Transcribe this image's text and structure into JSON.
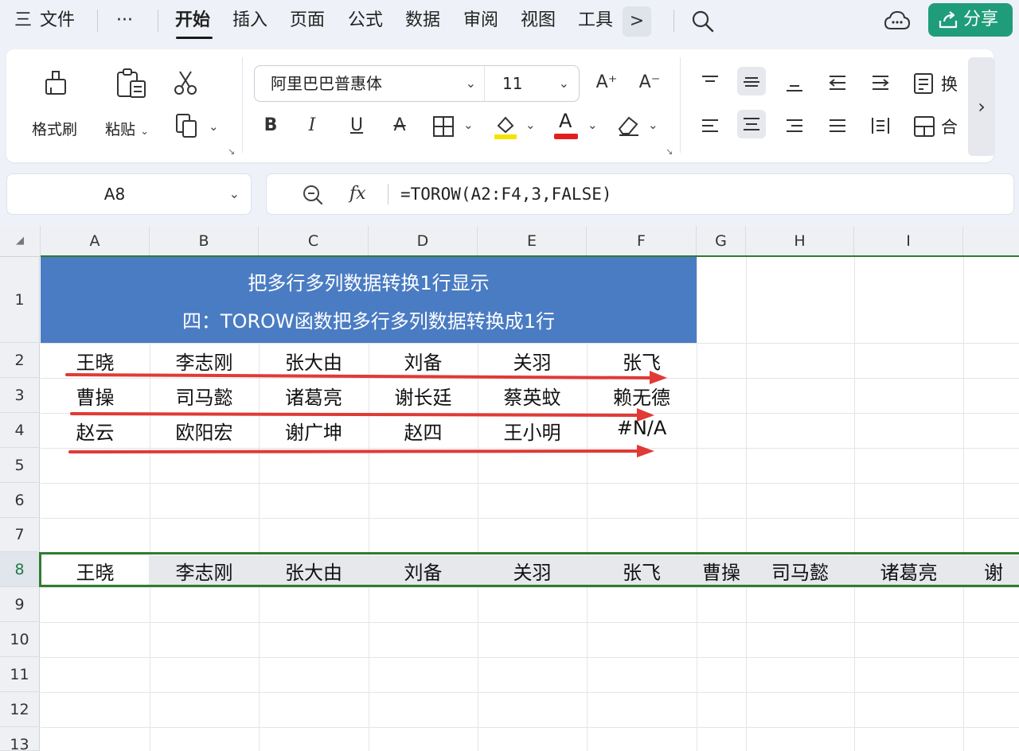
{
  "menubar": {
    "menu_label": "三",
    "file": "文件",
    "more": "···",
    "tabs": [
      "开始",
      "插入",
      "页面",
      "公式",
      "数据",
      "审阅",
      "视图",
      "工具"
    ],
    "tab_more": ">",
    "share": "分享"
  },
  "ribbon": {
    "format_painter": "格式刷",
    "paste": "粘贴",
    "font_name": "阿里巴巴普惠体",
    "font_size": "11",
    "bold": "B",
    "italic": "I",
    "underline": "U",
    "strike": "A",
    "font_color_letter": "A",
    "wrap_label": "换",
    "merge_label": "合",
    "increase_font": "A⁺",
    "decrease_font": "A⁻",
    "colors": {
      "highlight": "#f5e400",
      "font": "#e02020"
    }
  },
  "formula": {
    "cell_ref": "A8",
    "fx": "fx",
    "text": "=TOROW(A2:F4,3,FALSE)"
  },
  "grid": {
    "columns": [
      "A",
      "B",
      "C",
      "D",
      "E",
      "F",
      "G",
      "H",
      "I"
    ],
    "rows": [
      "1",
      "2",
      "3",
      "4",
      "5",
      "6",
      "7",
      "8",
      "9",
      "10",
      "11",
      "12",
      "13"
    ],
    "title_line1": "把多行多列数据转换1行显示",
    "title_line2": "四：TOROW函数把多行多列数据转换成1行",
    "title_fill": "#4a7cc3",
    "data": [
      [
        "王晓",
        "李志刚",
        "张大由",
        "刘备",
        "关羽",
        "张飞"
      ],
      [
        "曹操",
        "司马懿",
        "诸葛亮",
        "谢长廷",
        "蔡英蚊",
        "赖无德"
      ],
      [
        "赵云",
        "欧阳宏",
        "谢广坤",
        "赵四",
        "王小明",
        "#N/A"
      ]
    ],
    "row8": [
      "王晓",
      "李志刚",
      "张大由",
      "刘备",
      "关羽",
      "张飞",
      "曹操",
      "司马懿",
      "诸葛亮",
      "谢"
    ],
    "arrow_color": "#e03a36",
    "selection_color": "#2f7d2f"
  }
}
